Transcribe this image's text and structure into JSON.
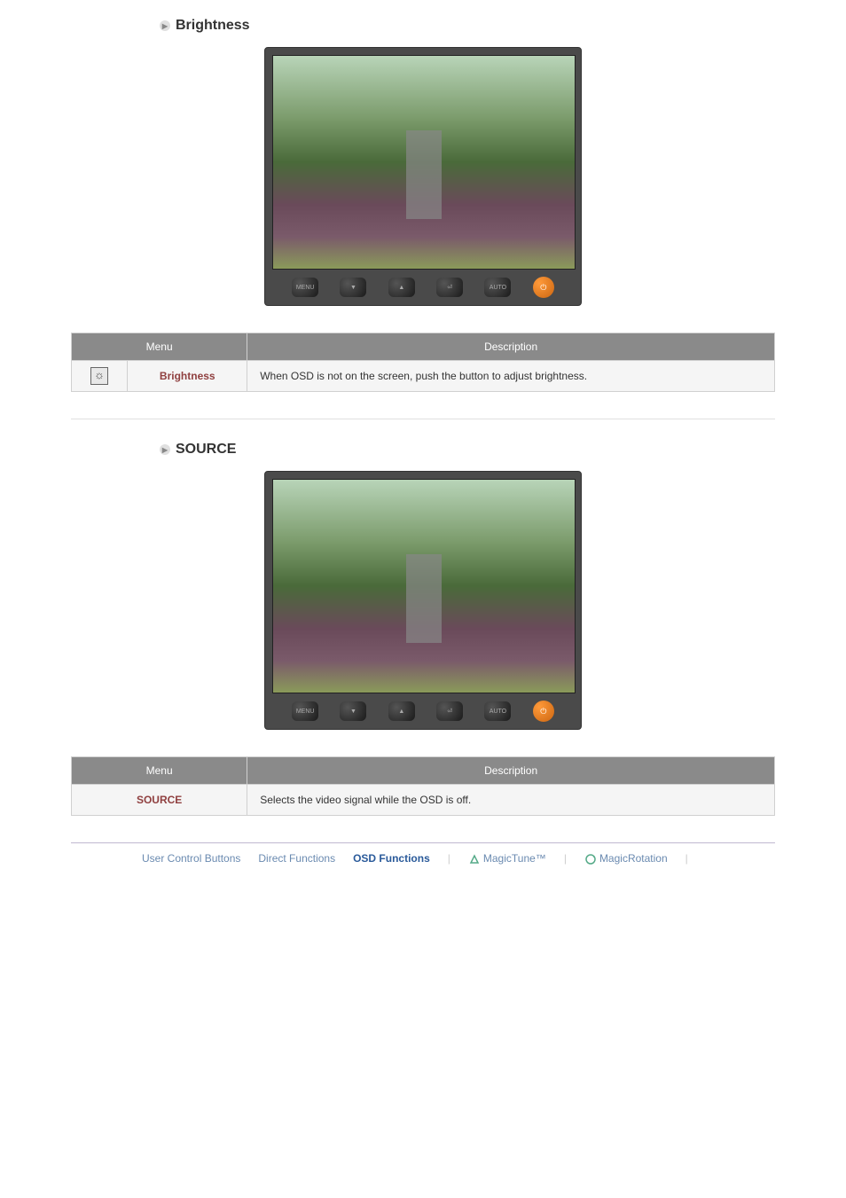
{
  "sections": {
    "brightness": {
      "title": "Brightness",
      "table": {
        "header_menu": "Menu",
        "header_desc": "Description",
        "row_label": "Brightness",
        "row_desc": "When OSD is not on the screen, push the button to adjust brightness."
      },
      "monitor_buttons": [
        "MENU",
        "▼",
        "▲",
        "⏎",
        "AUTO"
      ],
      "power_glyph": "⏻"
    },
    "source": {
      "title": "SOURCE",
      "table": {
        "header_menu": "Menu",
        "header_desc": "Description",
        "row_label": "SOURCE",
        "row_desc": "Selects the video signal while the OSD is off."
      },
      "monitor_buttons": [
        "MENU",
        "▼",
        "▲",
        "⏎",
        "AUTO"
      ],
      "power_glyph": "⏻"
    }
  },
  "brightness_icon_glyph": "☼",
  "nav": {
    "items": [
      {
        "label": "User Control Buttons"
      },
      {
        "label": "Direct Functions"
      },
      {
        "label": "OSD Functions"
      },
      {
        "label": "MagicTune™"
      },
      {
        "label": "MagicRotation"
      }
    ]
  }
}
